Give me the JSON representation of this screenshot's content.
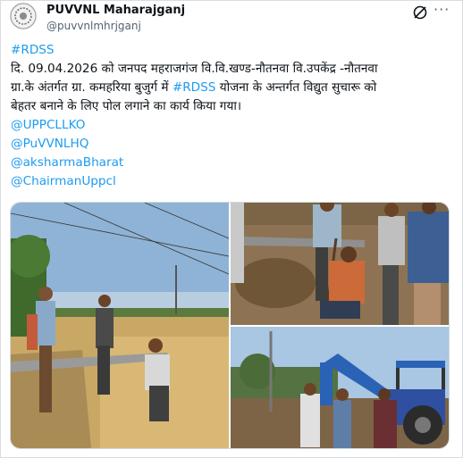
{
  "account": {
    "display_name": "PUVVNL Maharajganj",
    "handle": "@puvvnlmhrjganj"
  },
  "header_icons": [
    "grok-icon",
    "more-icon"
  ],
  "more_label": "···",
  "tweet": {
    "hashtag_top": "#RDSS",
    "line1": "दि. 09.04.2026 को जनपद महराजगंज वि.वि.खण्ड-नौतनवा वि.उपकेंद्र -नौतनवा",
    "line2_pre": "ग्रा.के अंतर्गत ग्रा. कमहरिया बुजुर्ग में ",
    "line2_tag": "#RDSS",
    "line2_post": " योजना के अन्तर्गत विद्युत सुचारू को",
    "line3": "बेहतर बनाने के लिए पोल लगाने का कार्य किया गया।",
    "mentions": [
      "@UPPCLLKO",
      "@PuVVNLHQ",
      "@aksharmaBharat",
      "@ChairmanUppcl"
    ]
  },
  "colors": {
    "link": "#1d9bf0",
    "text": "#0f1419",
    "secondary": "#536471",
    "border": "#cfd9de"
  }
}
